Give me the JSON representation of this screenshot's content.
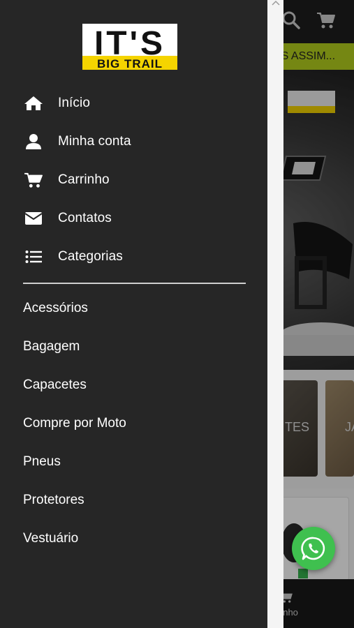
{
  "brand": {
    "logo_line1": "IT'S",
    "logo_line2": "BIG TRAIL",
    "accent_color": "#b4cf1e",
    "yellow": "#f5d400"
  },
  "drawer": {
    "main_menu": [
      {
        "label": "Início",
        "icon": "home-icon"
      },
      {
        "label": "Minha conta",
        "icon": "user-icon"
      },
      {
        "label": "Carrinho",
        "icon": "cart-icon"
      },
      {
        "label": "Contatos",
        "icon": "envelope-icon"
      },
      {
        "label": "Categorias",
        "icon": "list-icon"
      }
    ],
    "categories": [
      {
        "label": "Acessórios"
      },
      {
        "label": "Bagagem"
      },
      {
        "label": "Capacetes"
      },
      {
        "label": "Compre por Moto"
      },
      {
        "label": "Pneus"
      },
      {
        "label": "Protetores"
      },
      {
        "label": "Vestuário"
      }
    ]
  },
  "background": {
    "banner_text": "ES ASSIM...",
    "card1_text": "TES",
    "card2_text": "JA",
    "bottom_nav_label": "rinho"
  },
  "fab": {
    "icon": "whatsapp-icon",
    "color": "#3fc04f"
  }
}
